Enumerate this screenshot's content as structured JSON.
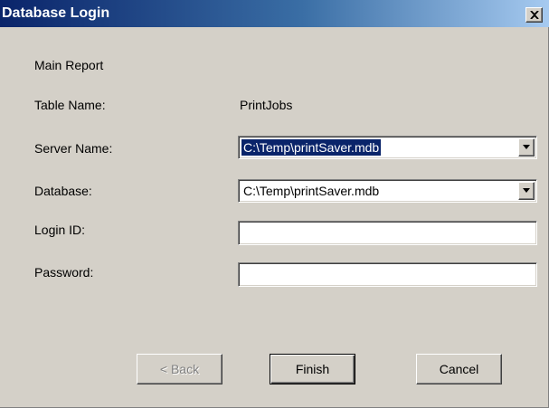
{
  "window": {
    "title": "Database Login"
  },
  "form": {
    "report_name": "Main Report",
    "table_name_label": "Table Name:",
    "table_name_value": "PrintJobs",
    "server_name_label": "Server Name:",
    "server_name_value": "C:\\Temp\\printSaver.mdb",
    "database_label": "Database:",
    "database_value": "C:\\Temp\\printSaver.mdb",
    "login_id_label": "Login ID:",
    "login_id_value": "",
    "password_label": "Password:",
    "password_value": ""
  },
  "buttons": {
    "back_label": "< Back",
    "finish_label": "Finish",
    "cancel_label": "Cancel"
  },
  "icons": {
    "close": "close-icon",
    "dropdown": "chevron-down-icon"
  },
  "colors": {
    "titlebar_start": "#0a246a",
    "titlebar_end": "#a6caf0",
    "dialog_face": "#d4d0c8",
    "selection": "#0a246a"
  }
}
